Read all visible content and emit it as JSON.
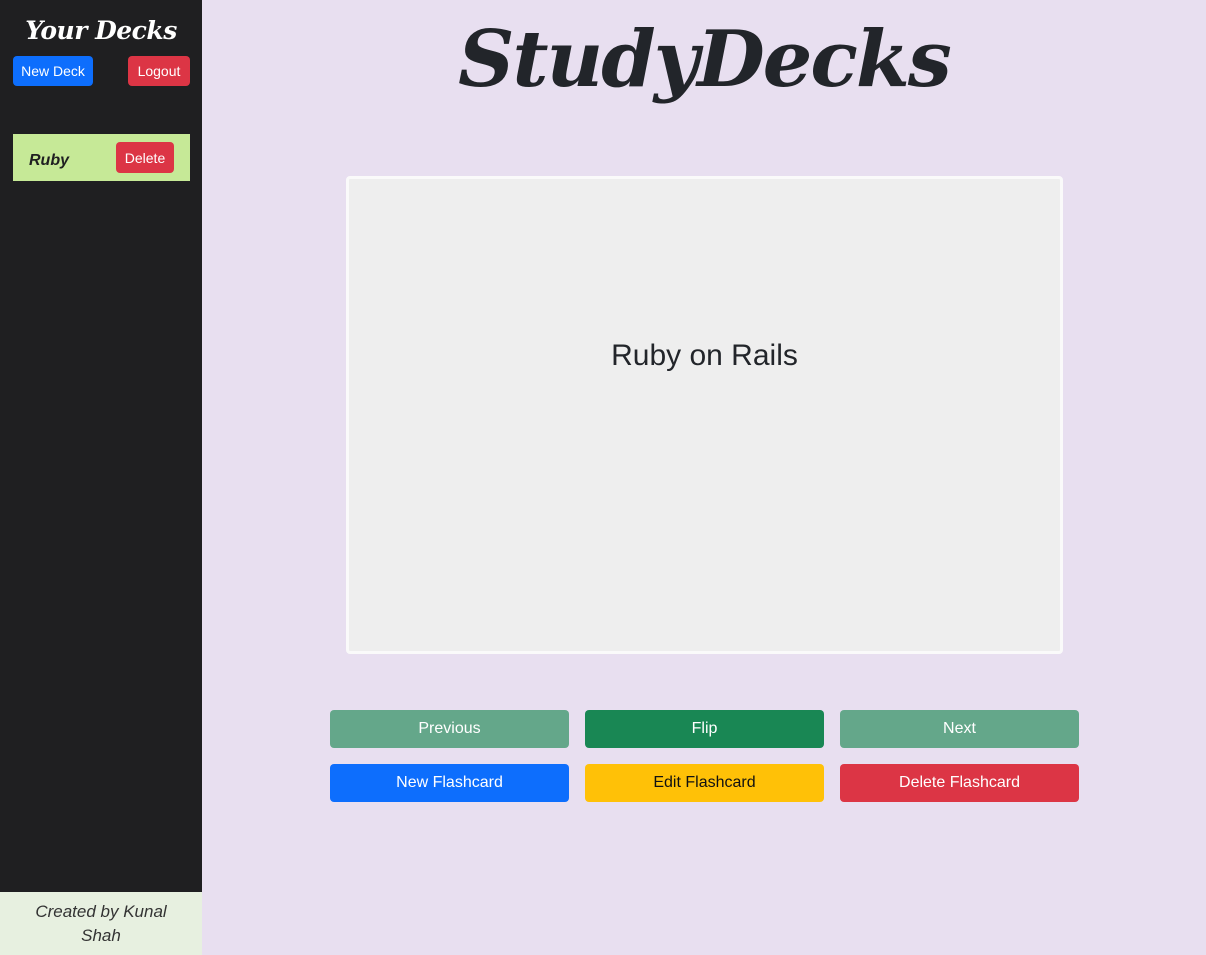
{
  "sidebar": {
    "title": "Your Decks",
    "new_deck_label": "New Deck",
    "logout_label": "Logout",
    "decks": [
      {
        "name": "Ruby",
        "delete_label": "Delete"
      }
    ],
    "footer_text": "Created by Kunal Shah"
  },
  "main": {
    "title": "StudyDecks",
    "card_text": "Ruby on Rails",
    "buttons": {
      "previous": "Previous",
      "flip": "Flip",
      "next": "Next",
      "new_flashcard": "New Flashcard",
      "edit_flashcard": "Edit Flashcard",
      "delete_flashcard": "Delete Flashcard"
    }
  },
  "colors": {
    "background": "#e8dff0",
    "sidebar": "#1f1f21",
    "deck_item": "#c6e997",
    "primary": "#0d6efd",
    "danger": "#dc3545",
    "success": "#198754",
    "success_faded": "#64a78a",
    "warning": "#ffc107"
  }
}
